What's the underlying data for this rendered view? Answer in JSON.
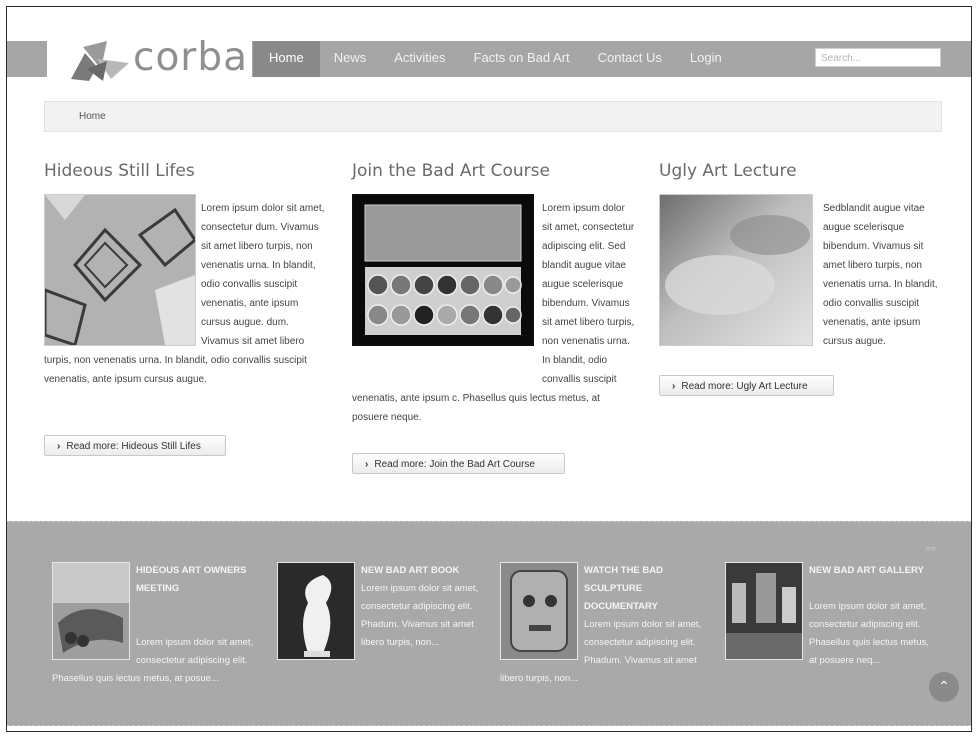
{
  "header": {
    "logo_text": "corba",
    "nav": [
      "Home",
      "News",
      "Activities",
      "Facts on Bad Art",
      "Contact Us",
      "Login"
    ],
    "search_placeholder": "Search..."
  },
  "breadcrumb": "Home",
  "articles": [
    {
      "title": "Hideous Still Lifes",
      "text": "Lorem ipsum dolor sit amet, consectetur dum. Vivamus sit amet libero turpis, non venenatis urna. In blandit, odio convallis suscipit venenatis, ante ipsum cursus augue. dum. Vivamus sit amet libero turpis, non venenatis urna. In blandit, odio convallis suscipit venenatis, ante ipsum cursus augue.",
      "read_more": "Read more: Hideous Still Lifes"
    },
    {
      "title": "Join the Bad Art Course",
      "text": "Lorem ipsum dolor sit amet, consectetur adipiscing elit. Sed blandit augue vitae augue scelerisque bibendum. Vivamus sit amet libero turpis, non venenatis urna. In blandit, odio convallis suscipit venenatis, ante ipsum c. Phasellus quis lectus metus, at posuere neque.",
      "read_more": "Read more: Join the Bad Art Course"
    },
    {
      "title": "Ugly Art Lecture",
      "text": "Sedblandit augue vitae augue scelerisque bibendum. Vivamus sit amet libero turpis, non venenatis urna. In blandit, odio convallis suscipit venenatis, ante ipsum cursus augue.",
      "read_more": "Read more: Ugly Art Lecture"
    }
  ],
  "features": [
    {
      "title": "Hideous Art Owners Meeting",
      "text": "Lorem ipsum dolor sit amet, consectetur adipiscing elit. Phasellus quis lectus metus, at posue..."
    },
    {
      "title": "New Bad Art Book",
      "text": "Lorem ipsum dolor sit amet, consectetur adipiscing elit. Phadum. Vivamus sit amet libero turpis, non..."
    },
    {
      "title": "Watch the Bad Sculpture Documentary",
      "text": "Lorem ipsum dolor sit amet, consectetur adipiscing elit. Phadum. Vivamus sit amet libero turpis, non..."
    },
    {
      "title": "New Bad Art Gallery",
      "text": "Lorem ipsum dolor sit amet, consectetur adipiscing elit. Phasellus quis lectus metus, at posuere neq..."
    }
  ],
  "icons": {
    "read_more": "chevron-right-icon",
    "back_to_top": "chevron-up-icon",
    "slider": "slider-dots-icon"
  },
  "colors": {
    "topbar": "#a6a6a6",
    "nav_active": "#8a8a8a",
    "band": "#a9a9a9"
  }
}
